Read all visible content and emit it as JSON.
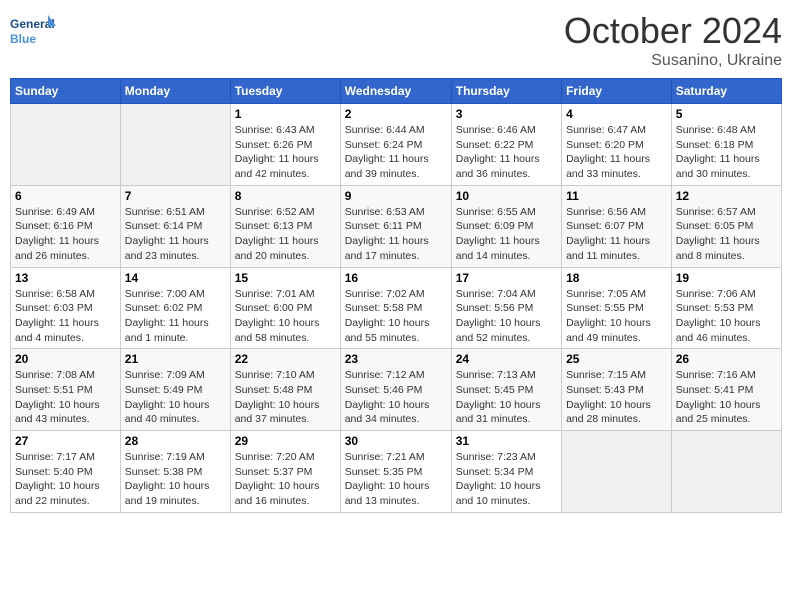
{
  "header": {
    "logo_general": "General",
    "logo_blue": "Blue",
    "month": "October 2024",
    "location": "Susanino, Ukraine"
  },
  "weekdays": [
    "Sunday",
    "Monday",
    "Tuesday",
    "Wednesday",
    "Thursday",
    "Friday",
    "Saturday"
  ],
  "weeks": [
    [
      {
        "day": "",
        "info": ""
      },
      {
        "day": "",
        "info": ""
      },
      {
        "day": "1",
        "info": "Sunrise: 6:43 AM\nSunset: 6:26 PM\nDaylight: 11 hours and 42 minutes."
      },
      {
        "day": "2",
        "info": "Sunrise: 6:44 AM\nSunset: 6:24 PM\nDaylight: 11 hours and 39 minutes."
      },
      {
        "day": "3",
        "info": "Sunrise: 6:46 AM\nSunset: 6:22 PM\nDaylight: 11 hours and 36 minutes."
      },
      {
        "day": "4",
        "info": "Sunrise: 6:47 AM\nSunset: 6:20 PM\nDaylight: 11 hours and 33 minutes."
      },
      {
        "day": "5",
        "info": "Sunrise: 6:48 AM\nSunset: 6:18 PM\nDaylight: 11 hours and 30 minutes."
      }
    ],
    [
      {
        "day": "6",
        "info": "Sunrise: 6:49 AM\nSunset: 6:16 PM\nDaylight: 11 hours and 26 minutes."
      },
      {
        "day": "7",
        "info": "Sunrise: 6:51 AM\nSunset: 6:14 PM\nDaylight: 11 hours and 23 minutes."
      },
      {
        "day": "8",
        "info": "Sunrise: 6:52 AM\nSunset: 6:13 PM\nDaylight: 11 hours and 20 minutes."
      },
      {
        "day": "9",
        "info": "Sunrise: 6:53 AM\nSunset: 6:11 PM\nDaylight: 11 hours and 17 minutes."
      },
      {
        "day": "10",
        "info": "Sunrise: 6:55 AM\nSunset: 6:09 PM\nDaylight: 11 hours and 14 minutes."
      },
      {
        "day": "11",
        "info": "Sunrise: 6:56 AM\nSunset: 6:07 PM\nDaylight: 11 hours and 11 minutes."
      },
      {
        "day": "12",
        "info": "Sunrise: 6:57 AM\nSunset: 6:05 PM\nDaylight: 11 hours and 8 minutes."
      }
    ],
    [
      {
        "day": "13",
        "info": "Sunrise: 6:58 AM\nSunset: 6:03 PM\nDaylight: 11 hours and 4 minutes."
      },
      {
        "day": "14",
        "info": "Sunrise: 7:00 AM\nSunset: 6:02 PM\nDaylight: 11 hours and 1 minute."
      },
      {
        "day": "15",
        "info": "Sunrise: 7:01 AM\nSunset: 6:00 PM\nDaylight: 10 hours and 58 minutes."
      },
      {
        "day": "16",
        "info": "Sunrise: 7:02 AM\nSunset: 5:58 PM\nDaylight: 10 hours and 55 minutes."
      },
      {
        "day": "17",
        "info": "Sunrise: 7:04 AM\nSunset: 5:56 PM\nDaylight: 10 hours and 52 minutes."
      },
      {
        "day": "18",
        "info": "Sunrise: 7:05 AM\nSunset: 5:55 PM\nDaylight: 10 hours and 49 minutes."
      },
      {
        "day": "19",
        "info": "Sunrise: 7:06 AM\nSunset: 5:53 PM\nDaylight: 10 hours and 46 minutes."
      }
    ],
    [
      {
        "day": "20",
        "info": "Sunrise: 7:08 AM\nSunset: 5:51 PM\nDaylight: 10 hours and 43 minutes."
      },
      {
        "day": "21",
        "info": "Sunrise: 7:09 AM\nSunset: 5:49 PM\nDaylight: 10 hours and 40 minutes."
      },
      {
        "day": "22",
        "info": "Sunrise: 7:10 AM\nSunset: 5:48 PM\nDaylight: 10 hours and 37 minutes."
      },
      {
        "day": "23",
        "info": "Sunrise: 7:12 AM\nSunset: 5:46 PM\nDaylight: 10 hours and 34 minutes."
      },
      {
        "day": "24",
        "info": "Sunrise: 7:13 AM\nSunset: 5:45 PM\nDaylight: 10 hours and 31 minutes."
      },
      {
        "day": "25",
        "info": "Sunrise: 7:15 AM\nSunset: 5:43 PM\nDaylight: 10 hours and 28 minutes."
      },
      {
        "day": "26",
        "info": "Sunrise: 7:16 AM\nSunset: 5:41 PM\nDaylight: 10 hours and 25 minutes."
      }
    ],
    [
      {
        "day": "27",
        "info": "Sunrise: 7:17 AM\nSunset: 5:40 PM\nDaylight: 10 hours and 22 minutes."
      },
      {
        "day": "28",
        "info": "Sunrise: 7:19 AM\nSunset: 5:38 PM\nDaylight: 10 hours and 19 minutes."
      },
      {
        "day": "29",
        "info": "Sunrise: 7:20 AM\nSunset: 5:37 PM\nDaylight: 10 hours and 16 minutes."
      },
      {
        "day": "30",
        "info": "Sunrise: 7:21 AM\nSunset: 5:35 PM\nDaylight: 10 hours and 13 minutes."
      },
      {
        "day": "31",
        "info": "Sunrise: 7:23 AM\nSunset: 5:34 PM\nDaylight: 10 hours and 10 minutes."
      },
      {
        "day": "",
        "info": ""
      },
      {
        "day": "",
        "info": ""
      }
    ]
  ]
}
